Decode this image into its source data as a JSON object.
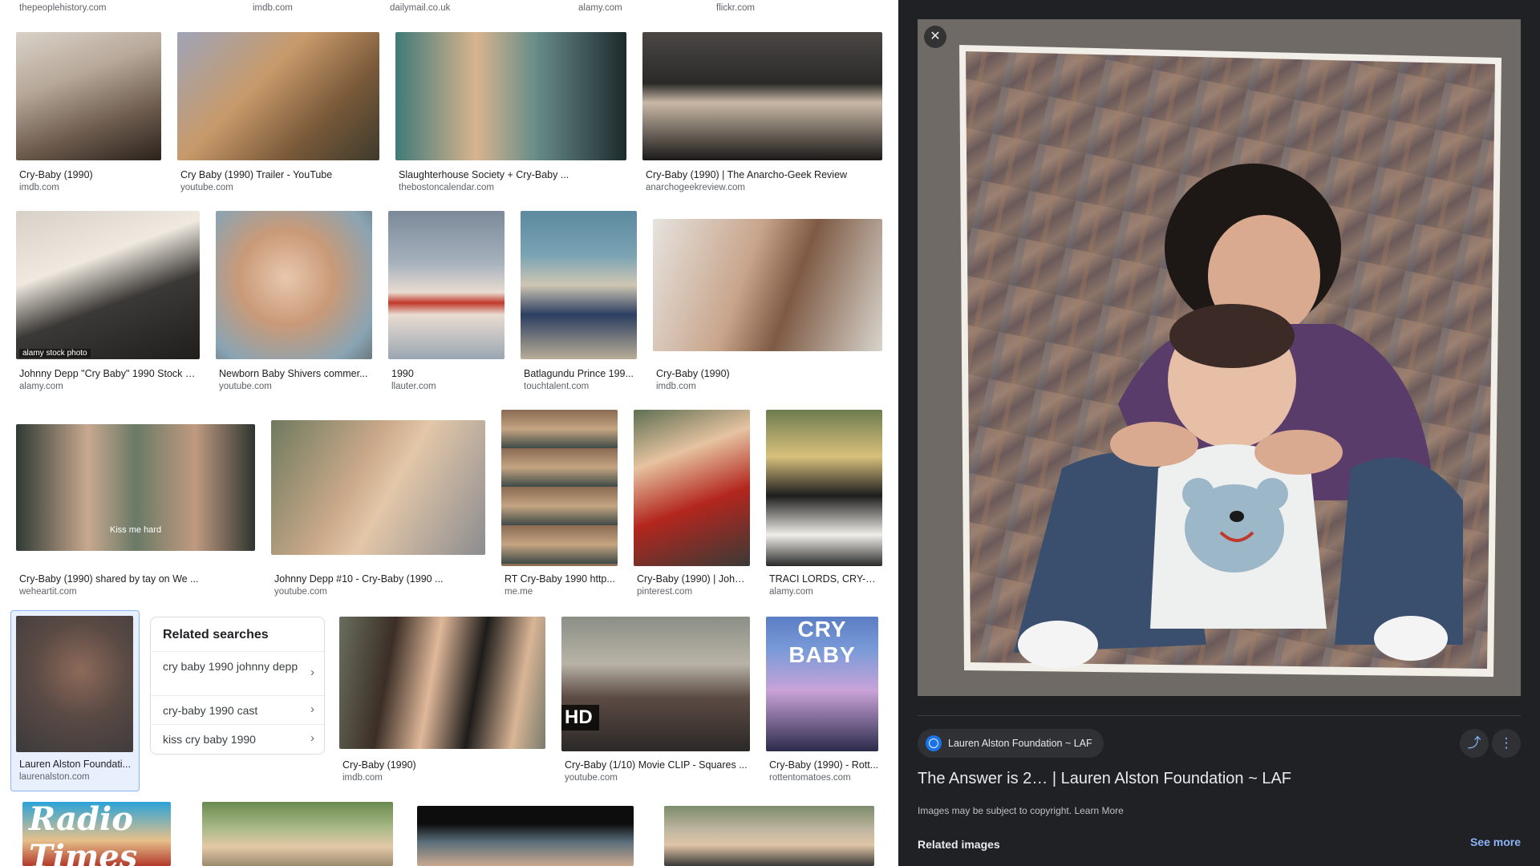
{
  "top_sources": [
    "thepeoplehistory.com",
    "imdb.com",
    "dailymail.co.uk",
    "alamy.com",
    "flickr.com"
  ],
  "row1": [
    {
      "title": "Cry-Baby (1990)",
      "source": "imdb.com"
    },
    {
      "title": "Cry Baby (1990) Trailer - YouTube",
      "source": "youtube.com"
    },
    {
      "title": "Slaughterhouse Society + Cry-Baby ...",
      "source": "thebostoncalendar.com"
    },
    {
      "title": "Cry-Baby (1990) | The Anarcho-Geek Review",
      "source": "anarchogeekreview.com"
    }
  ],
  "row2": [
    {
      "title": "Johnny Depp \"Cry Baby\" 1990 Stock P...",
      "source": "alamy.com",
      "watermark": "alamy stock photo"
    },
    {
      "title": "Newborn Baby Shivers commer...",
      "source": "youtube.com"
    },
    {
      "title": "1990",
      "source": "llauter.com"
    },
    {
      "title": "Batlagundu Prince 199...",
      "source": "touchtalent.com"
    },
    {
      "title": "Cry-Baby (1990)",
      "source": "imdb.com"
    }
  ],
  "row3": [
    {
      "title": "Cry-Baby (1990) shared by tay on We ...",
      "source": "weheartit.com",
      "overlay": "Kiss me hard"
    },
    {
      "title": "Johnny Depp #10 - Cry-Baby (1990 ...",
      "source": "youtube.com"
    },
    {
      "title": "RT Cry-Baby 1990 http...",
      "source": "me.me"
    },
    {
      "title": "Cry-Baby (1990) | John...",
      "source": "pinterest.com"
    },
    {
      "title": "TRACI LORDS, CRY-BA...",
      "source": "alamy.com"
    }
  ],
  "row4": [
    {
      "title": "Lauren Alston Foundati...",
      "source": "laurenalston.com"
    },
    {
      "title": "Cry-Baby (1990)",
      "source": "imdb.com"
    },
    {
      "title": "Cry-Baby (1/10) Movie CLIP - Squares ...",
      "source": "youtube.com",
      "badge": "HD"
    },
    {
      "title": "Cry-Baby (1990) - Rott...",
      "source": "rottentomatoes.com",
      "poster_text": "CRY BABY"
    }
  ],
  "row5": [
    {
      "poster_text": "Radio Times"
    }
  ],
  "related_searches": {
    "title": "Related searches",
    "items": [
      "cry baby 1990 johnny depp",
      "cry-baby 1990 cast",
      "kiss cry baby 1990"
    ]
  },
  "viewer": {
    "source_label": "Lauren Alston Foundation ~ LAF",
    "title": "The Answer is 2… | Lauren Alston Foundation ~ LAF",
    "copyright_text": "Images may be subject to copyright.",
    "learn_more": "Learn More",
    "related_images": "Related images",
    "see_more": "See more",
    "close_glyph": "✕",
    "share_glyph": "⤴",
    "more_glyph": "⋮"
  },
  "colors": {
    "viewer_bg": "#202124",
    "accent": "#8ab4f8",
    "selected_border": "#8ab4f8"
  },
  "icons": [
    "close-icon",
    "globe-icon",
    "share-icon",
    "more-vert-icon",
    "chevron-right-icon"
  ]
}
